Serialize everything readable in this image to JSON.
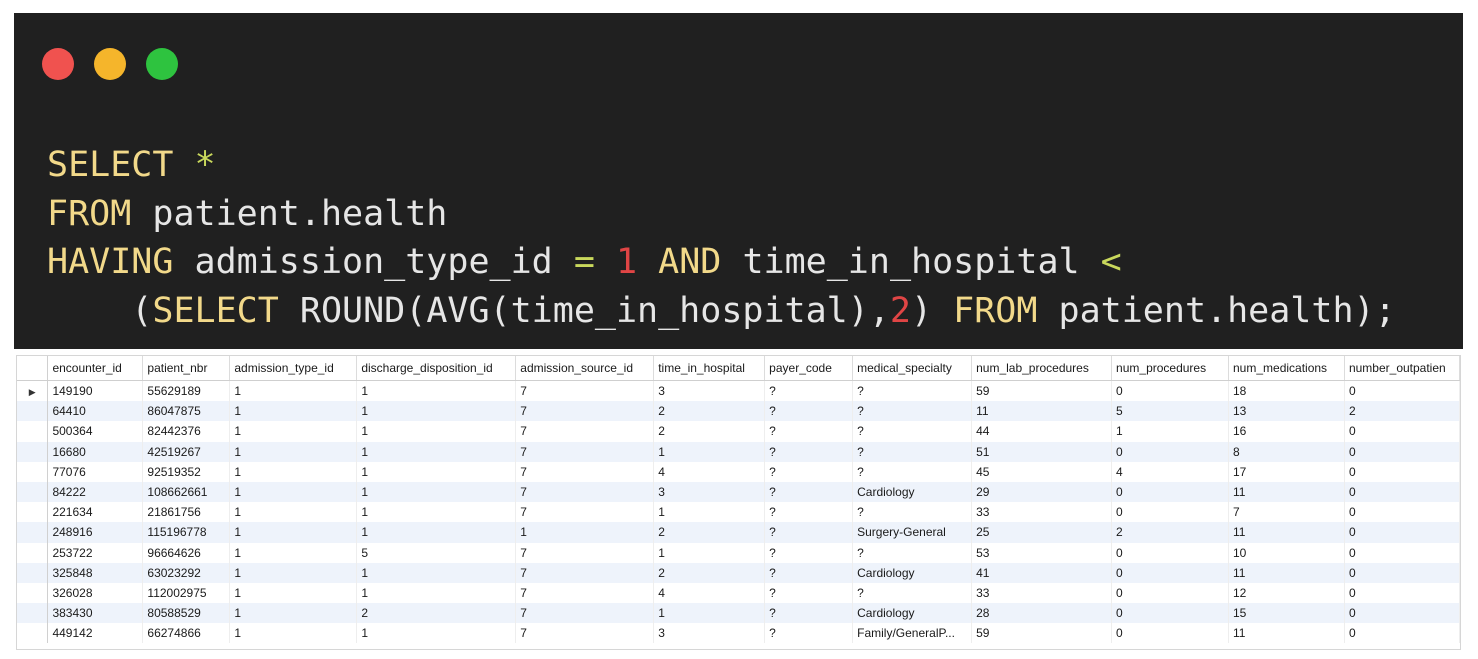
{
  "window": {
    "traffic_lights": [
      {
        "name": "close",
        "color": "#f0524f"
      },
      {
        "name": "minimize",
        "color": "#f5b52b"
      },
      {
        "name": "maximize",
        "color": "#2ec33f"
      }
    ]
  },
  "sql": {
    "line1": {
      "kw": "SELECT",
      "star": "*"
    },
    "line2": {
      "kw": "FROM",
      "table": "patient.health"
    },
    "line3": {
      "kw": "HAVING",
      "col": "admission_type_id",
      "eq": "=",
      "val": "1",
      "and": "AND",
      "col2": "time_in_hospital",
      "lt": "<"
    },
    "line4": {
      "open": "(",
      "select": "SELECT",
      "func": "ROUND(AVG(time_in_hospital),",
      "num": "2",
      "close": ")",
      "from": "FROM",
      "table": "patient.health);"
    }
  },
  "colors": {
    "keyword": "#f2d98a",
    "operator": "#c9d85c",
    "number": "#e04545",
    "editor_bg": "#202020",
    "alt_row": "#eef3fb"
  },
  "results": {
    "columns": [
      "encounter_id",
      "patient_nbr",
      "admission_type_id",
      "discharge_disposition_id",
      "admission_source_id",
      "time_in_hospital",
      "payer_code",
      "medical_specialty",
      "num_lab_procedures",
      "num_procedures",
      "num_medications",
      "number_outpatien"
    ],
    "rows": [
      [
        "149190",
        "55629189",
        "1",
        "1",
        "7",
        "3",
        "?",
        "?",
        "59",
        "0",
        "18",
        "0"
      ],
      [
        "64410",
        "86047875",
        "1",
        "1",
        "7",
        "2",
        "?",
        "?",
        "11",
        "5",
        "13",
        "2"
      ],
      [
        "500364",
        "82442376",
        "1",
        "1",
        "7",
        "2",
        "?",
        "?",
        "44",
        "1",
        "16",
        "0"
      ],
      [
        "16680",
        "42519267",
        "1",
        "1",
        "7",
        "1",
        "?",
        "?",
        "51",
        "0",
        "8",
        "0"
      ],
      [
        "77076",
        "92519352",
        "1",
        "1",
        "7",
        "4",
        "?",
        "?",
        "45",
        "4",
        "17",
        "0"
      ],
      [
        "84222",
        "108662661",
        "1",
        "1",
        "7",
        "3",
        "?",
        "Cardiology",
        "29",
        "0",
        "11",
        "0"
      ],
      [
        "221634",
        "21861756",
        "1",
        "1",
        "7",
        "1",
        "?",
        "?",
        "33",
        "0",
        "7",
        "0"
      ],
      [
        "248916",
        "115196778",
        "1",
        "1",
        "1",
        "2",
        "?",
        "Surgery-General",
        "25",
        "2",
        "11",
        "0"
      ],
      [
        "253722",
        "96664626",
        "1",
        "5",
        "7",
        "1",
        "?",
        "?",
        "53",
        "0",
        "10",
        "0"
      ],
      [
        "325848",
        "63023292",
        "1",
        "1",
        "7",
        "2",
        "?",
        "Cardiology",
        "41",
        "0",
        "11",
        "0"
      ],
      [
        "326028",
        "112002975",
        "1",
        "1",
        "7",
        "4",
        "?",
        "?",
        "33",
        "0",
        "12",
        "0"
      ],
      [
        "383430",
        "80588529",
        "1",
        "2",
        "7",
        "1",
        "?",
        "Cardiology",
        "28",
        "0",
        "15",
        "0"
      ],
      [
        "449142",
        "66274866",
        "1",
        "1",
        "7",
        "3",
        "?",
        "Family/GeneralP...",
        "59",
        "0",
        "11",
        "0"
      ]
    ],
    "selected_row": 0,
    "row_marker_icon": "current-row-arrow-icon"
  }
}
